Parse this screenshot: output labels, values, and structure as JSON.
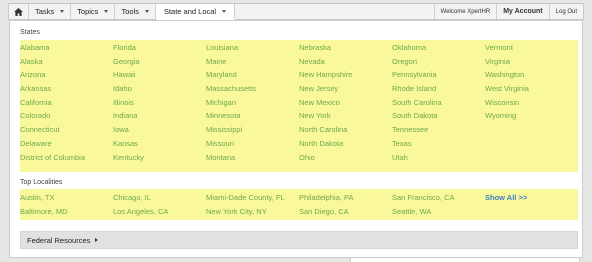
{
  "nav": {
    "tasks": "Tasks",
    "topics": "Topics",
    "tools": "Tools",
    "state_local": "State and Local",
    "welcome": "Welcome XpertHR",
    "my_account": "My Account",
    "log_out": "Log Out"
  },
  "states_title": "States",
  "states": [
    "Alabama",
    "Florida",
    "Louisiana",
    "Nebraska",
    "Oklahoma",
    "Vermont",
    "Alaska",
    "Georgia",
    "Maine",
    "Nevada",
    "Oregon",
    "Virginia",
    "Arizona",
    "Hawaii",
    "Maryland",
    "New Hampshire",
    "Pennsylvania",
    "Washington",
    "Arkansas",
    "Idaho",
    "Massachusetts",
    "New Jersey",
    "Rhode Island",
    "West Virginia",
    "California",
    "Illinois",
    "Michigan",
    "New Mexico",
    "South Carolina",
    "Wisconsin",
    "Colorado",
    "Indiana",
    "Minnesota",
    "New York",
    "South Dakota",
    "Wyoming",
    "Connecticut",
    "Iowa",
    "Mississippi",
    "North Carolina",
    "Tennessee",
    "",
    "Delaware",
    "Kansas",
    "Missouri",
    "North Dakota",
    "Texas",
    "",
    "District of Columbia",
    "Kentucky",
    "Montana",
    "Ohio",
    "Utah",
    ""
  ],
  "localities_title": "Top Localities",
  "localities": [
    "Austin, TX",
    "Chicago, IL",
    "Miami-Dade County, FL",
    "Philadelphia, PA",
    "San Francisco, CA",
    "Show All >>",
    "Baltimore, MD",
    "Los Angeles, CA",
    "New York City, NY",
    "San Diego, CA",
    "Seattle, WA",
    ""
  ],
  "federal_label": "Federal Resources",
  "colors": {
    "link": "#6fa84b",
    "highlight": "#f9f99b",
    "show_all": "#3d80c4"
  }
}
